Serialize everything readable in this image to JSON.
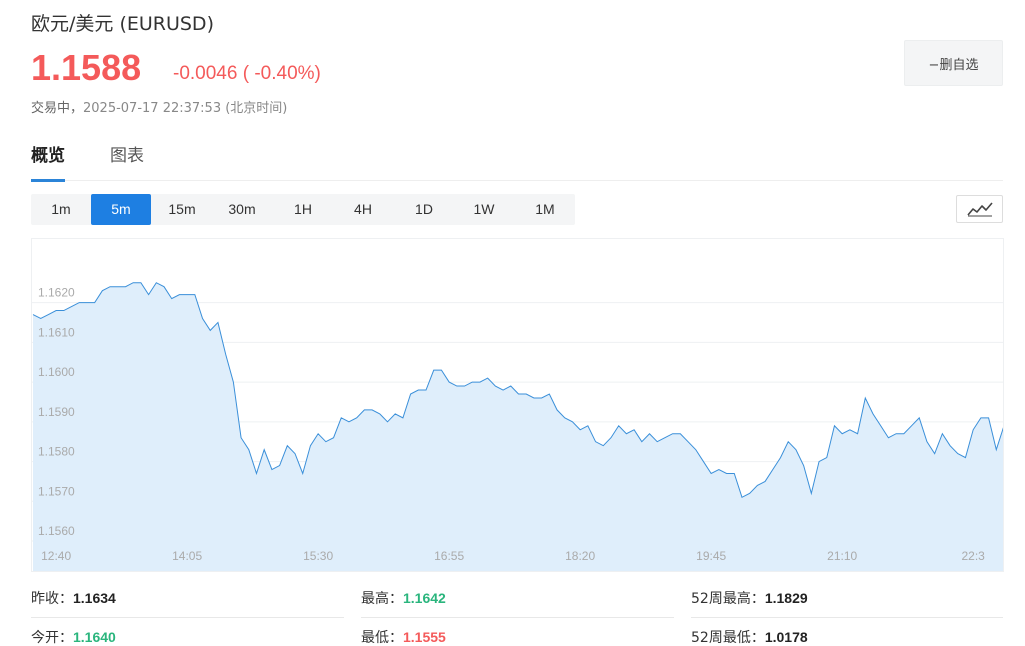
{
  "header": {
    "title": "欧元/美元  (EURUSD)",
    "price": "1.1588",
    "change": "-0.0046 ( -0.40%)",
    "status": "交易中，",
    "timestamp": "2025-07-17 22:37:53",
    "timezone": "(北京时间)",
    "remove_watchlist": "−删自选"
  },
  "tabs": [
    {
      "label": "概览",
      "active": true
    },
    {
      "label": "图表",
      "active": false
    }
  ],
  "intervals": [
    {
      "label": "1m",
      "active": false
    },
    {
      "label": "5m",
      "active": true
    },
    {
      "label": "15m",
      "active": false
    },
    {
      "label": "30m",
      "active": false
    },
    {
      "label": "1H",
      "active": false
    },
    {
      "label": "4H",
      "active": false
    },
    {
      "label": "1D",
      "active": false
    },
    {
      "label": "1W",
      "active": false
    },
    {
      "label": "1M",
      "active": false
    }
  ],
  "chart_type_icon": "line-chart-icon",
  "colors": {
    "up": "#f45a5a",
    "down": "#2ab57d",
    "accent": "#1e7fe2",
    "line": "#3a8fd9",
    "fill": "#dfeefb"
  },
  "chart_data": {
    "type": "area",
    "ylim": [
      1.1558,
      1.1636
    ],
    "y_ticks": [
      "1.1560",
      "1.1570",
      "1.1580",
      "1.1590",
      "1.1600",
      "1.1610",
      "1.1620"
    ],
    "x_ticks": [
      "12:40",
      "14:05",
      "15:30",
      "16:55",
      "18:20",
      "19:45",
      "21:10",
      "22:3"
    ],
    "x_tick_index": [
      3,
      20,
      37,
      54,
      71,
      88,
      105,
      122
    ],
    "values": [
      1.1617,
      1.1616,
      1.1617,
      1.1618,
      1.1618,
      1.1619,
      1.162,
      1.162,
      1.162,
      1.1623,
      1.1624,
      1.1624,
      1.1624,
      1.1625,
      1.1625,
      1.1622,
      1.1625,
      1.1624,
      1.1621,
      1.1622,
      1.1622,
      1.1622,
      1.1616,
      1.1613,
      1.1615,
      1.1607,
      1.16,
      1.1586,
      1.1583,
      1.1577,
      1.1583,
      1.1578,
      1.1579,
      1.1584,
      1.1582,
      1.1577,
      1.1584,
      1.1587,
      1.1585,
      1.1586,
      1.1591,
      1.159,
      1.1591,
      1.1593,
      1.1593,
      1.1592,
      1.159,
      1.1592,
      1.1591,
      1.1597,
      1.1598,
      1.1598,
      1.1603,
      1.1603,
      1.16,
      1.1599,
      1.1599,
      1.16,
      1.16,
      1.1601,
      1.1599,
      1.1598,
      1.1599,
      1.1597,
      1.1597,
      1.1596,
      1.1596,
      1.1597,
      1.1593,
      1.1591,
      1.159,
      1.1588,
      1.1589,
      1.1585,
      1.1584,
      1.1586,
      1.1589,
      1.1587,
      1.1588,
      1.1585,
      1.1587,
      1.1585,
      1.1586,
      1.1587,
      1.1587,
      1.1585,
      1.1583,
      1.158,
      1.1577,
      1.1578,
      1.1577,
      1.1577,
      1.1571,
      1.1572,
      1.1574,
      1.1575,
      1.1578,
      1.1581,
      1.1585,
      1.1583,
      1.1579,
      1.1572,
      1.158,
      1.1581,
      1.1589,
      1.1587,
      1.1588,
      1.1587,
      1.1596,
      1.1592,
      1.1589,
      1.1586,
      1.1587,
      1.1587,
      1.1589,
      1.1591,
      1.1585,
      1.1582,
      1.1587,
      1.1584,
      1.1582,
      1.1581,
      1.1588,
      1.1591,
      1.1591,
      1.1583,
      1.1589
    ]
  },
  "stats": {
    "prev_close_label": "昨收：",
    "prev_close": "1.1634",
    "high_label": "最高：",
    "high": "1.1642",
    "week52_high_label": "52周最高：",
    "week52_high": "1.1829",
    "open_label": "今开：",
    "open": "1.1640",
    "low_label": "最低：",
    "low": "1.1555",
    "week52_low_label": "52周最低：",
    "week52_low": "1.0178"
  }
}
